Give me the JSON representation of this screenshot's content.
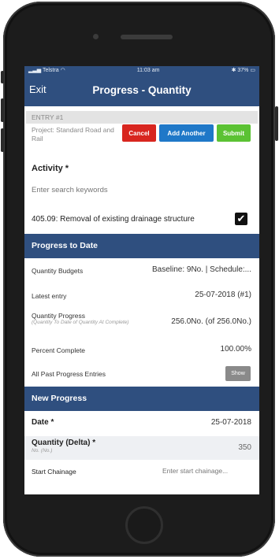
{
  "status_bar": {
    "carrier": "Telstra",
    "time": "11:03 am",
    "battery": "37%"
  },
  "nav": {
    "exit_label": "Exit",
    "title": "Progress - Quantity"
  },
  "entry": {
    "header": "ENTRY #1",
    "project": "Project: Standard Road and Rail",
    "cancel_label": "Cancel",
    "add_another_label": "Add Another",
    "submit_label": "Submit"
  },
  "activity": {
    "label": "Activity *",
    "search_placeholder": "Enter search keywords",
    "selected_item": "405.09: Removal of existing drainage structure",
    "checked": true
  },
  "progress_to_date": {
    "header": "Progress to Date",
    "quantity_budgets_label": "Quantity Budgets",
    "quantity_budgets_value": "Baseline: 9No. | Schedule:...",
    "latest_entry_label": "Latest entry",
    "latest_entry_value": "25-07-2018 (#1)",
    "quantity_progress_label": "Quantity Progress",
    "quantity_progress_sub": "(Quantity To Date of Quantity At Complete)",
    "quantity_progress_value": "256.0No. (of 256.0No.)",
    "percent_complete_label": "Percent Complete",
    "percent_complete_value": "100.00%",
    "past_entries_label": "All Past Progress Entries",
    "show_label": "Show"
  },
  "new_progress": {
    "header": "New Progress",
    "date_label": "Date *",
    "date_value": "25-07-2018",
    "quantity_label": "Quantity (Delta) *",
    "quantity_sub": "No. (No.)",
    "quantity_value": "350",
    "start_chainage_label": "Start Chainage",
    "start_chainage_placeholder": "Enter start chainage..."
  },
  "colors": {
    "primary": "#2f4f7f",
    "cancel": "#d8261f",
    "add_another": "#1f78c8",
    "submit": "#5bc233"
  }
}
